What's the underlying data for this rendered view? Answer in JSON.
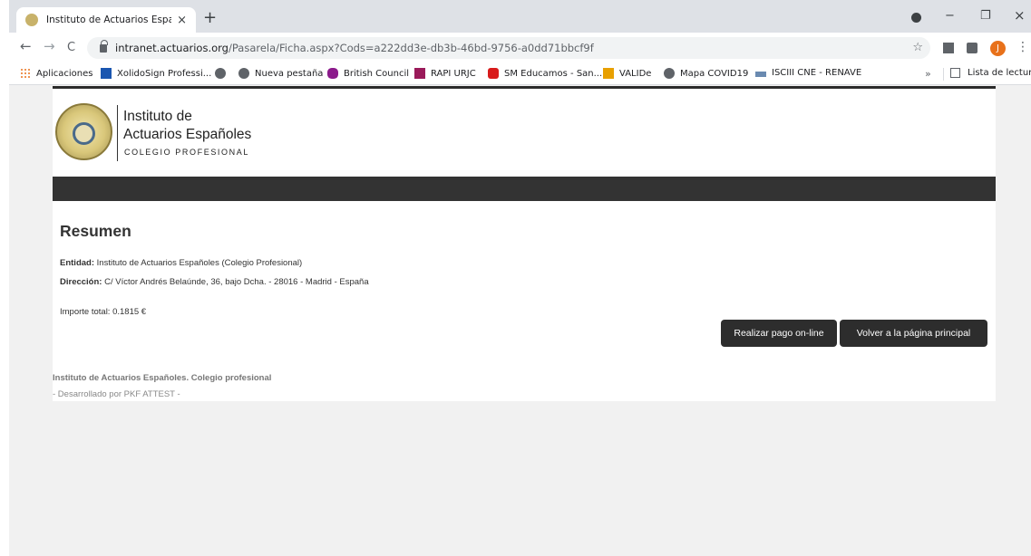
{
  "browser": {
    "tab_title": "Instituto de Actuarios Españoles.",
    "tab_close": "×",
    "new_tab": "+",
    "minimize": "−",
    "restore": "❐",
    "close": "×",
    "url_host": "intranet.actuarios.org",
    "url_path": "/Pasarela/Ficha.aspx?Cods=a222dd3e-db3b-46bd-9756-a0dd71bbcf9f",
    "back": "←",
    "forward": "→",
    "reload": "C",
    "star": "☆",
    "avatar_letter": "J",
    "menu": "⋮"
  },
  "bookmarks": {
    "items": [
      {
        "label": "Aplicaciones",
        "color": "#e8711a"
      },
      {
        "label": "XolidoSign Professi...",
        "color": "#1a56b0"
      },
      {
        "label": "",
        "color": "#5f6368"
      },
      {
        "label": "Nueva pestaña",
        "color": "#5f6368"
      },
      {
        "label": "British Council",
        "color": "#8b1a8b"
      },
      {
        "label": "RAPI URJC",
        "color": "#9a1a5a"
      },
      {
        "label": "SM Educamos - San...",
        "color": "#d81b1b"
      },
      {
        "label": "VALIDe",
        "color": "#e8a000"
      },
      {
        "label": "Mapa COVID19",
        "color": "#5f6368"
      },
      {
        "label": "ISCIII CNE - RENAVE",
        "color": "#6a8ab0"
      }
    ],
    "more": "»",
    "reading_list": "Lista de lectura"
  },
  "logo": {
    "line1": "Instituto de",
    "line2": "Actuarios Españoles",
    "line3": "COLEGIO PROFESIONAL"
  },
  "summary": {
    "heading": "Resumen",
    "entidad_label": "Entidad:",
    "entidad_value": "Instituto de Actuarios Españoles (Colegio Profesional)",
    "direccion_label": "Dirección:",
    "direccion_value": "C/ Víctor Andrés Belaúnde, 36, bajo Dcha. - 28016 - Madrid - España",
    "importe": "Importe total: 0.1815 €"
  },
  "buttons": {
    "pay": "Realizar pago on-line",
    "back_home": "Volver a la página principal"
  },
  "footer": {
    "line1": "Instituto de Actuarios Españoles. Colegio profesional",
    "line2": "- Desarrollado por  PKF ATTEST  -"
  }
}
